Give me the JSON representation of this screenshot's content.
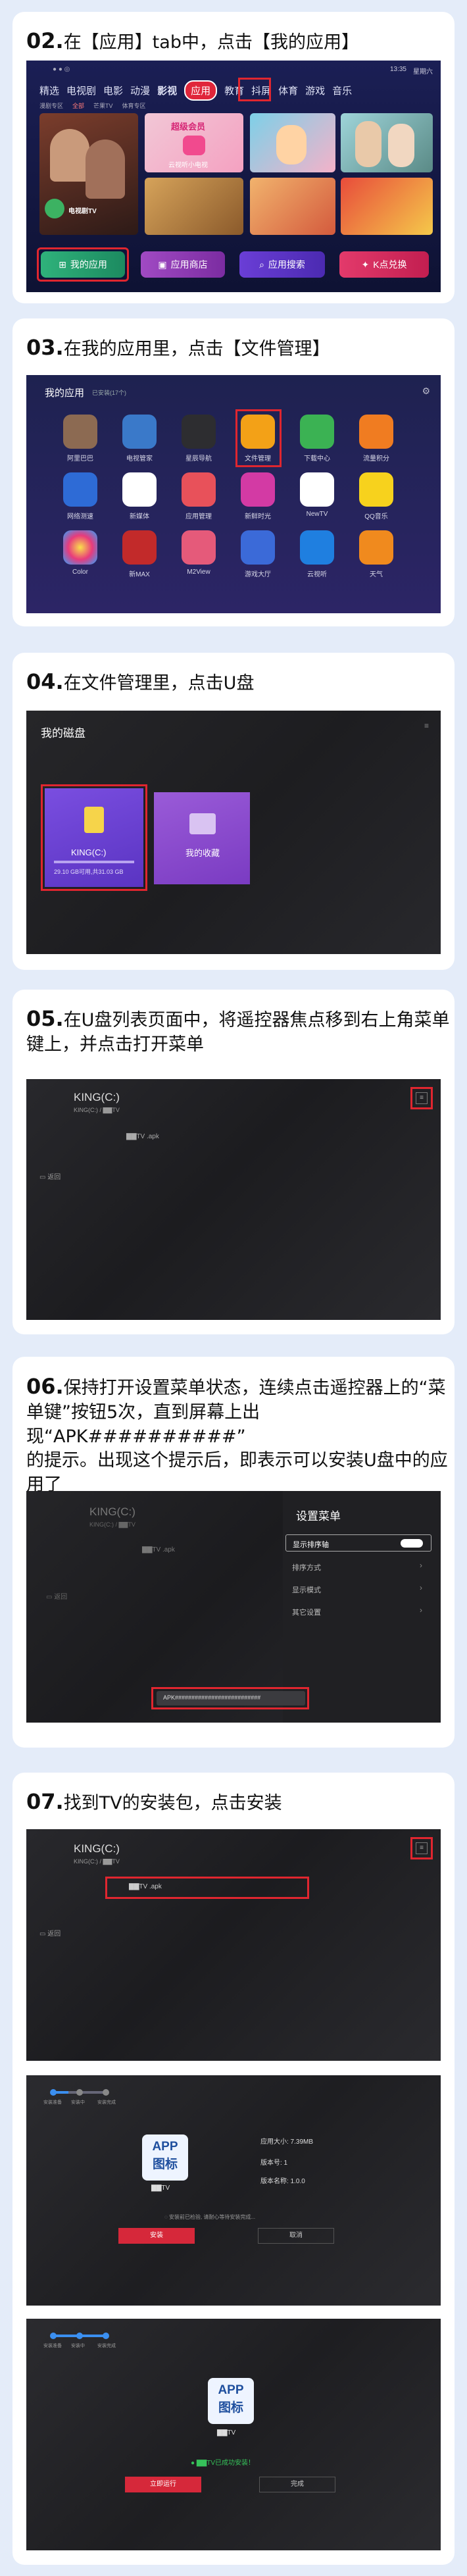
{
  "step02": {
    "num": "02.",
    "title": "在【应用】tab中，点击【我的应用】",
    "status_time": "13:35",
    "status_weekday": "星期六",
    "tabs": [
      "精选",
      "电视剧",
      "电影",
      "动漫",
      "影视",
      "应用",
      "教育",
      "抖屏",
      "体育",
      "游戏",
      "音乐"
    ],
    "subtabs": [
      "漫剧专区",
      "全部",
      "芒果TV",
      "体育专区"
    ],
    "banner_left_caption": "电视剧TV",
    "banner_top_center": "超级会员",
    "banner_caption_center": "云视听小电视",
    "buttons": [
      "我的应用",
      "应用商店",
      "应用搜索",
      "K点兑换"
    ]
  },
  "step03": {
    "num": "03.",
    "title": "在我的应用里，点击【文件管理】",
    "header": "我的应用",
    "header_sub": "已安装(17个)",
    "apps_row1": [
      "阿里巴巴",
      "电视管家",
      "星辰导航",
      "文件管理",
      "下载中心",
      "流量积分"
    ],
    "apps_row2": [
      "网络测速",
      "新媒体",
      "应用管理",
      "新鲜时光",
      "NewTV",
      "QQ音乐"
    ],
    "apps_row3": [
      "Color",
      "新MAX",
      "M2View",
      "游戏大厅",
      "云视听",
      "天气"
    ]
  },
  "step04": {
    "num": "04.",
    "title": "在文件管理里，点击U盘",
    "header": "我的磁盘",
    "drive_name": "KING(C:)",
    "drive_info": "29.10 GB可用,共31.03 GB",
    "fav_label": "我的收藏"
  },
  "step05": {
    "num": "05.",
    "title_line1": "在U盘列表页面中，将遥控器焦点移到右上角菜单",
    "title_line2": "键上，并点击打开菜单",
    "path": "KING(C:)",
    "path_sub": "KING(C:) / ▇▇TV",
    "file": "▇▇TV .apk",
    "side": "返回"
  },
  "step06": {
    "num": "06.",
    "title_line1": "保持打开设置菜单状态，连续点击遥控器上的“菜",
    "title_line2": "单键”按钮5次，直到屏幕上出现“APK##########”",
    "title_line3": "的提示。出现这个提示后，即表示可以安装U盘中的应",
    "title_line4": "用了",
    "path": "KING(C:)",
    "path_sub": "KING(C:) / ▇▇TV",
    "file": "▇▇TV .apk",
    "side": "返回",
    "menu_title": "设置菜单",
    "menu_items": [
      "显示排序轴",
      "排序方式",
      "显示模式",
      "其它设置"
    ],
    "toast": "APK##########################"
  },
  "step07": {
    "num": "07.",
    "title": "找到TV的安装包，点击安装",
    "path": "KING(C:)",
    "path_sub": "KING(C:) / ▇▇TV",
    "file": "▇▇TV .apk",
    "side": "返回",
    "steps": [
      "安装准备",
      "安装中",
      "安装完成"
    ],
    "app_icon_line1": "APP",
    "app_icon_line2": "图标",
    "app_name": "▇▇TV",
    "info_size": "应用大小: 7.39MB",
    "info_version": "版本号: 1",
    "info_name": "版本名称: 1.0.0",
    "loading_hint": "安装前已检验, 请耐心等待安装完成...",
    "btn_install": "安装",
    "btn_cancel": "取消",
    "success": "▇▇TV已成功安装！",
    "btn_open": "立即运行",
    "btn_done": "完成"
  },
  "colors": {
    "accent": "#e0262f",
    "bg": "#e4ecf9"
  }
}
